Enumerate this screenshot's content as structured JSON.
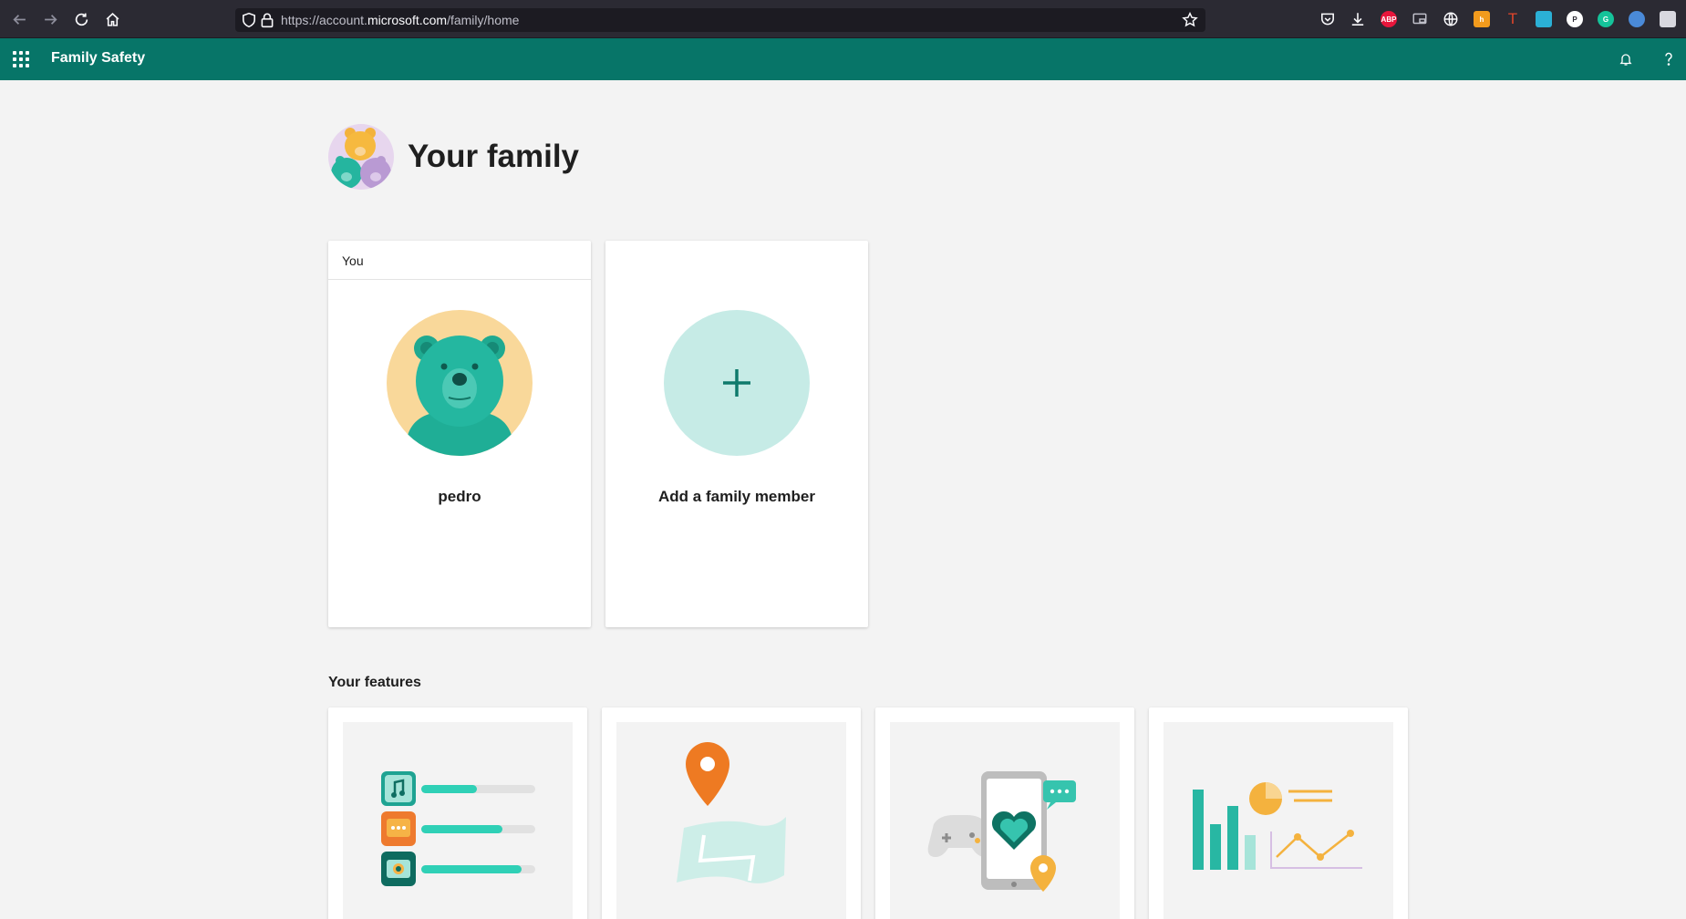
{
  "browser": {
    "url_prefix": "https://account.",
    "url_host": "microsoft.com",
    "url_path": "/family/home"
  },
  "app": {
    "title": "Family Safety"
  },
  "page": {
    "title": "Your family"
  },
  "member_card": {
    "header": "You",
    "name": "pedro"
  },
  "add_card": {
    "label": "Add a family member"
  },
  "features": {
    "title": "Your features"
  },
  "colors": {
    "header_green": "#077568",
    "accent_teal": "#2ec4b0",
    "add_circle": "#c6ebe6"
  }
}
